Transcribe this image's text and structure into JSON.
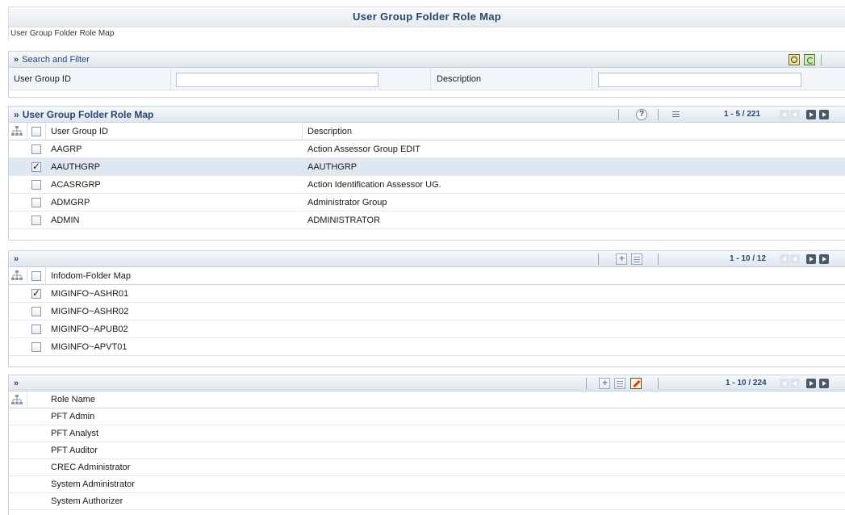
{
  "page": {
    "title": "User Group Folder Role Map",
    "breadcrumb": "User Group Folder Role Map"
  },
  "search_filter": {
    "title": "Search and Filter",
    "chevron": "»",
    "user_group_id_label": "User Group ID",
    "user_group_id_value": "",
    "description_label": "Description",
    "description_value": "",
    "icons": [
      "search-icon",
      "reset-icon"
    ]
  },
  "ugfr_grid": {
    "title": "User Group Folder Role Map",
    "chevron": "»",
    "help": "?",
    "pager": "1 - 5 / 221",
    "columns": [
      "User Group ID",
      "Description"
    ],
    "rows": [
      {
        "id": "AAGRP",
        "description": "Action Assessor Group EDIT",
        "checked": false
      },
      {
        "id": "AAUTHGRP",
        "description": "AAUTHGRP",
        "checked": true
      },
      {
        "id": "ACASRGRP",
        "description": "Action Identification Assessor UG.",
        "checked": false
      },
      {
        "id": "ADMGRP",
        "description": "Administrator Group",
        "checked": false
      },
      {
        "id": "ADMIN",
        "description": "ADMINISTRATOR",
        "checked": false
      }
    ]
  },
  "infodom_grid": {
    "chevron": "»",
    "pager": "1 - 10 / 12",
    "columns": [
      "Infodom-Folder Map"
    ],
    "rows": [
      {
        "name": "MIGINFO~ASHR01",
        "checked": true
      },
      {
        "name": "MIGINFO~ASHR02",
        "checked": false
      },
      {
        "name": "MIGINFO~APUB02",
        "checked": false
      },
      {
        "name": "MIGINFO~APVT01",
        "checked": false
      }
    ]
  },
  "role_grid": {
    "chevron": "»",
    "pager": "1 - 10 / 224",
    "columns": [
      "Role Name"
    ],
    "rows": [
      "PFT Admin",
      "PFT Analyst",
      "PFT Auditor",
      "CREC Administrator",
      "System Administrator",
      "System Authorizer"
    ]
  },
  "colors": {
    "title_text": "#27466c",
    "selected_row": "#dfe7f0",
    "bar_gradient_end": "#dfe6ee"
  }
}
